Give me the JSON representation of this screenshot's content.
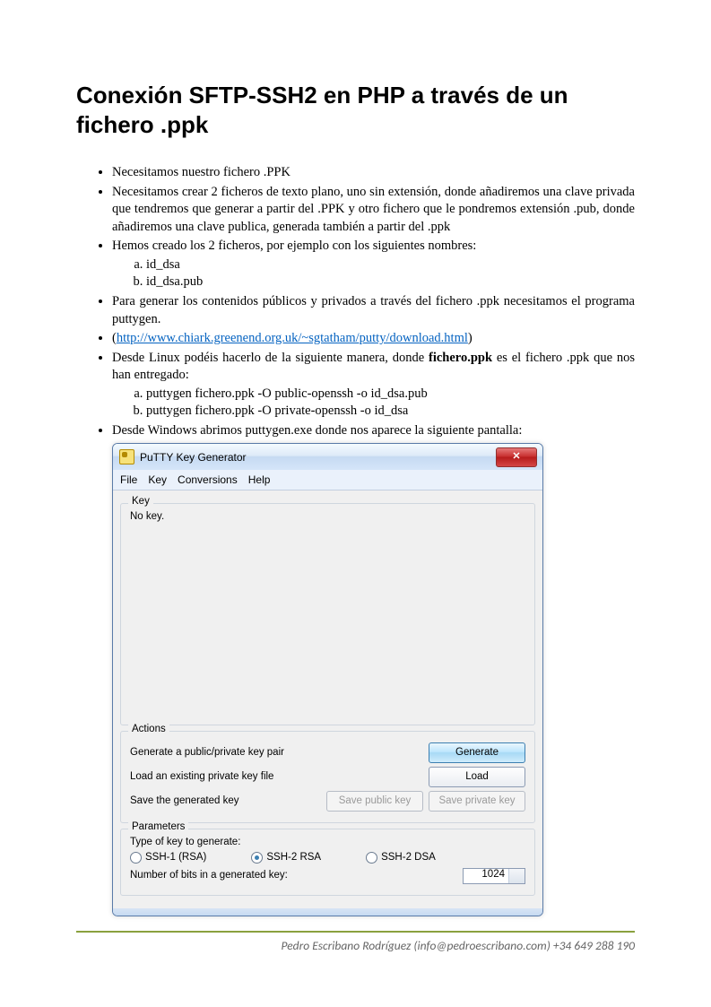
{
  "title": "Conexión SFTP-SSH2 en PHP a través de un fichero .ppk",
  "bullets": {
    "b1": "Necesitamos nuestro fichero .PPK",
    "b2": "Necesitamos crear 2 ficheros de texto plano, uno sin extensión, donde añadiremos una clave privada que tendremos que generar a partir del  .PPK y otro fichero que le pondremos extensión .pub, donde añadiremos una clave publica, generada también a partir del .ppk",
    "b3": "Hemos creado los 2 ficheros, por ejemplo con los siguientes nombres:",
    "b3a": "id_dsa",
    "b3b": "id_dsa.pub",
    "b4": "Para generar los contenidos públicos y privados a través del fichero .ppk necesitamos el programa puttygen.",
    "b5_open": "(",
    "b5_link": "http://www.chiark.greenend.org.uk/~sgtatham/putty/download.html",
    "b5_close": ")",
    "b6_pre": "Desde Linux podéis hacerlo de la siguiente manera, donde ",
    "b6_bold": "fichero.ppk",
    "b6_post": " es el fichero .ppk que nos han entregado:",
    "b6a": "puttygen fichero.ppk -O public-openssh -o id_dsa.pub",
    "b6b": "puttygen fichero.ppk -O private-openssh -o id_dsa",
    "b7": "Desde Windows abrimos  puttygen.exe donde nos aparece la siguiente pantalla:"
  },
  "putty": {
    "title": "PuTTY Key Generator",
    "menu": {
      "file": "File",
      "key": "Key",
      "conversions": "Conversions",
      "help": "Help"
    },
    "key_group": {
      "title": "Key",
      "nokey": "No key."
    },
    "actions": {
      "title": "Actions",
      "gen_label": "Generate a public/private key pair",
      "gen_btn": "Generate",
      "load_label": "Load an existing private key file",
      "load_btn": "Load",
      "save_label": "Save the generated key",
      "save_pub_btn": "Save public key",
      "save_priv_btn": "Save private key"
    },
    "params": {
      "title": "Parameters",
      "type_label": "Type of key to generate:",
      "r1": "SSH-1 (RSA)",
      "r2": "SSH-2 RSA",
      "r3": "SSH-2 DSA",
      "bits_label": "Number of bits in a generated key:",
      "bits_value": "1024"
    }
  },
  "footer": "Pedro Escribano Rodríguez (info@pedroescribano.com) +34 649 288 190"
}
